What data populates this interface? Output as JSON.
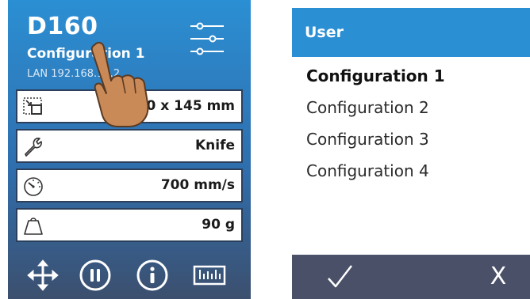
{
  "device": {
    "title": "D160",
    "configuration": "Configuration 1",
    "lan": "LAN 192.168.10.2",
    "icons": {
      "settings": "sliders-icon"
    },
    "rows": [
      {
        "icon": "media-size-icon",
        "value": "500 x 145 mm"
      },
      {
        "icon": "wrench-icon",
        "value": "Knife"
      },
      {
        "icon": "gauge-icon",
        "value": "700 mm/s"
      },
      {
        "icon": "weight-icon",
        "value": "90 g"
      }
    ],
    "toolbar": [
      "move-arrows-icon",
      "pause-icon",
      "info-icon",
      "ruler-icon"
    ]
  },
  "user_panel": {
    "header": "User",
    "configurations": [
      "Configuration 1",
      "Configuration 2",
      "Configuration 3",
      "Configuration 4"
    ],
    "selected_index": 0,
    "confirm_icon": "checkmark-icon",
    "cancel_label": "X"
  },
  "colors": {
    "header_blue": "#2b8fd3",
    "footer_dark": "#4a5068",
    "row_border": "#2b3f5c"
  }
}
